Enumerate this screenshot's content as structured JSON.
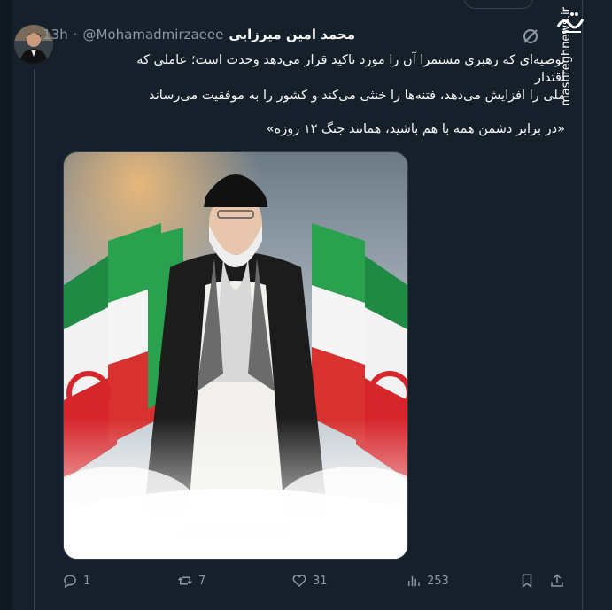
{
  "tweet": {
    "author_name": "محمد امین میرزایی",
    "handle": "@Mohamadmirzaeee",
    "separator": "·",
    "time": "13h",
    "text_line1": "توصیه‌ای که رهبری مستمرا آن را مورد تاکید قرار می‌دهد وحدت است؛ عاملی که اقتدار",
    "text_line2": "ملی را افزایش می‌دهد، فتنه‌ها را خنثی می‌کند و کشور را به موفقیت می‌رساند",
    "quote": "«در برابر دشمن همه با هم باشید، همانند جنگ ۱۲ روزه»"
  },
  "actions": {
    "replies": "1",
    "reposts": "7",
    "likes": "31",
    "views": "253"
  },
  "watermark": {
    "site": "mashreghnews.ir",
    "logo_icon": "mashregh-logo-icon"
  },
  "colors": {
    "background": "#15202b",
    "text": "#f7f9f9",
    "muted": "#8b98a5",
    "border": "#38444d"
  },
  "icons": [
    "grok-icon",
    "reply-icon",
    "repost-icon",
    "like-icon",
    "views-icon",
    "bookmark-icon",
    "share-icon"
  ]
}
